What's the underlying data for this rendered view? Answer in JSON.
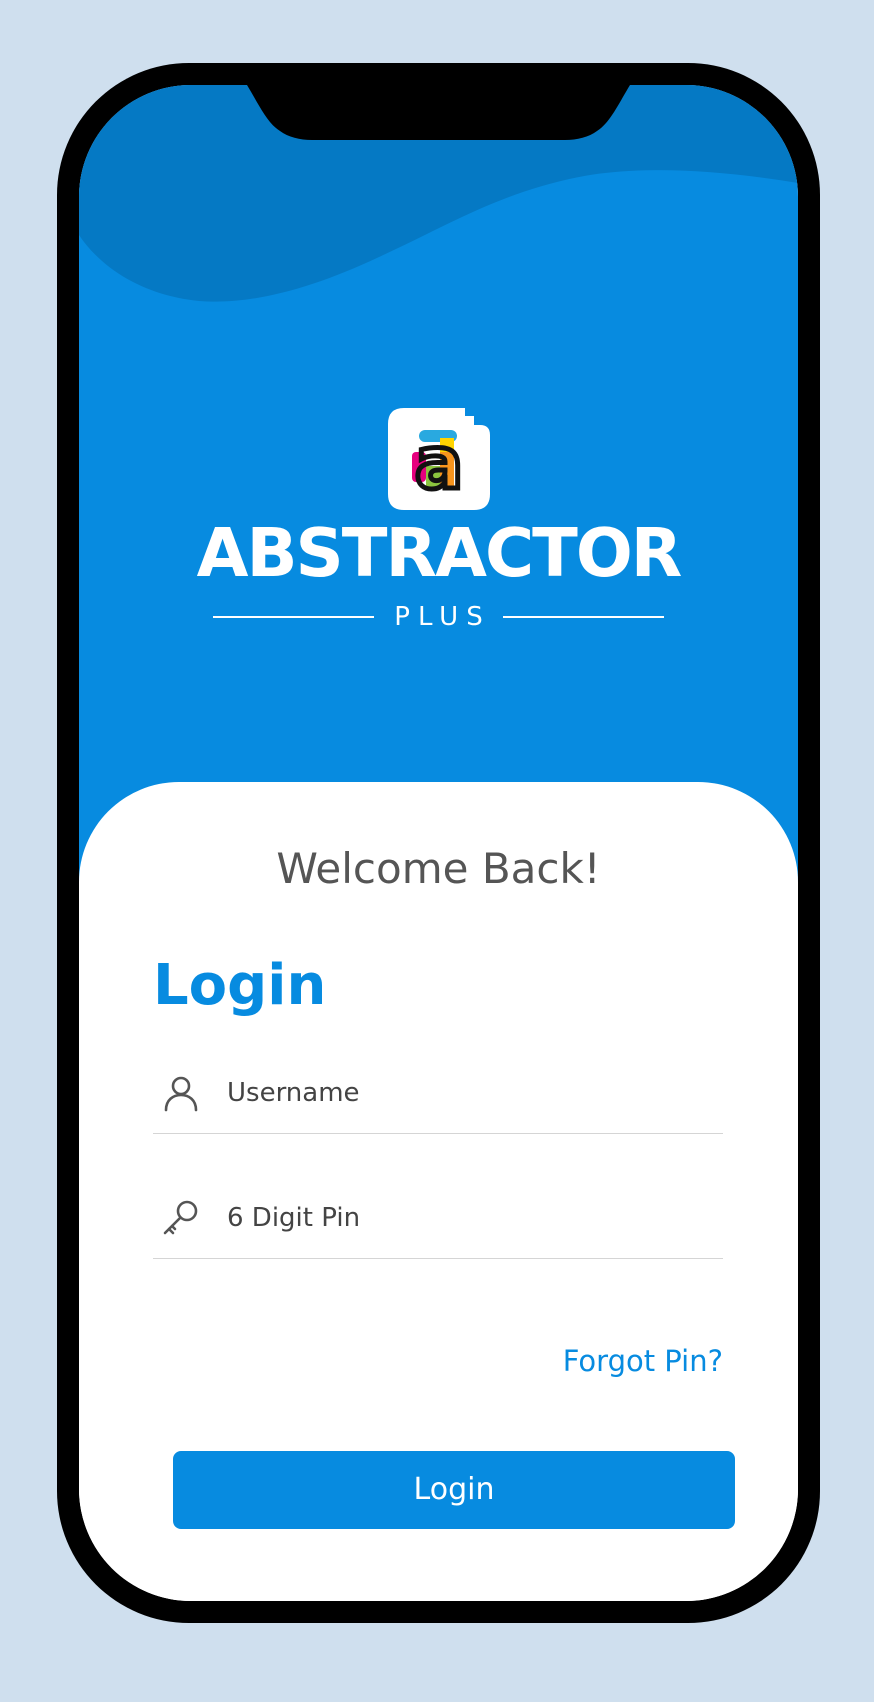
{
  "brand": {
    "title": "ABSTRACTOR",
    "subtitle": "PLUS",
    "logo_letter": "a"
  },
  "welcome_text": "Welcome Back!",
  "login_heading": "Login",
  "fields": {
    "username": {
      "placeholder": "Username",
      "value": "",
      "icon": "user-icon"
    },
    "pin": {
      "placeholder": "6 Digit Pin",
      "value": "",
      "icon": "key-icon"
    }
  },
  "forgot_pin_label": "Forgot Pin?",
  "login_button_label": "Login",
  "colors": {
    "primary": "#078be0",
    "primary_dark": "#0579c4",
    "page_background": "#cfdfee",
    "frame": "#000000",
    "card": "#ffffff",
    "welcome_text": "#555555"
  }
}
